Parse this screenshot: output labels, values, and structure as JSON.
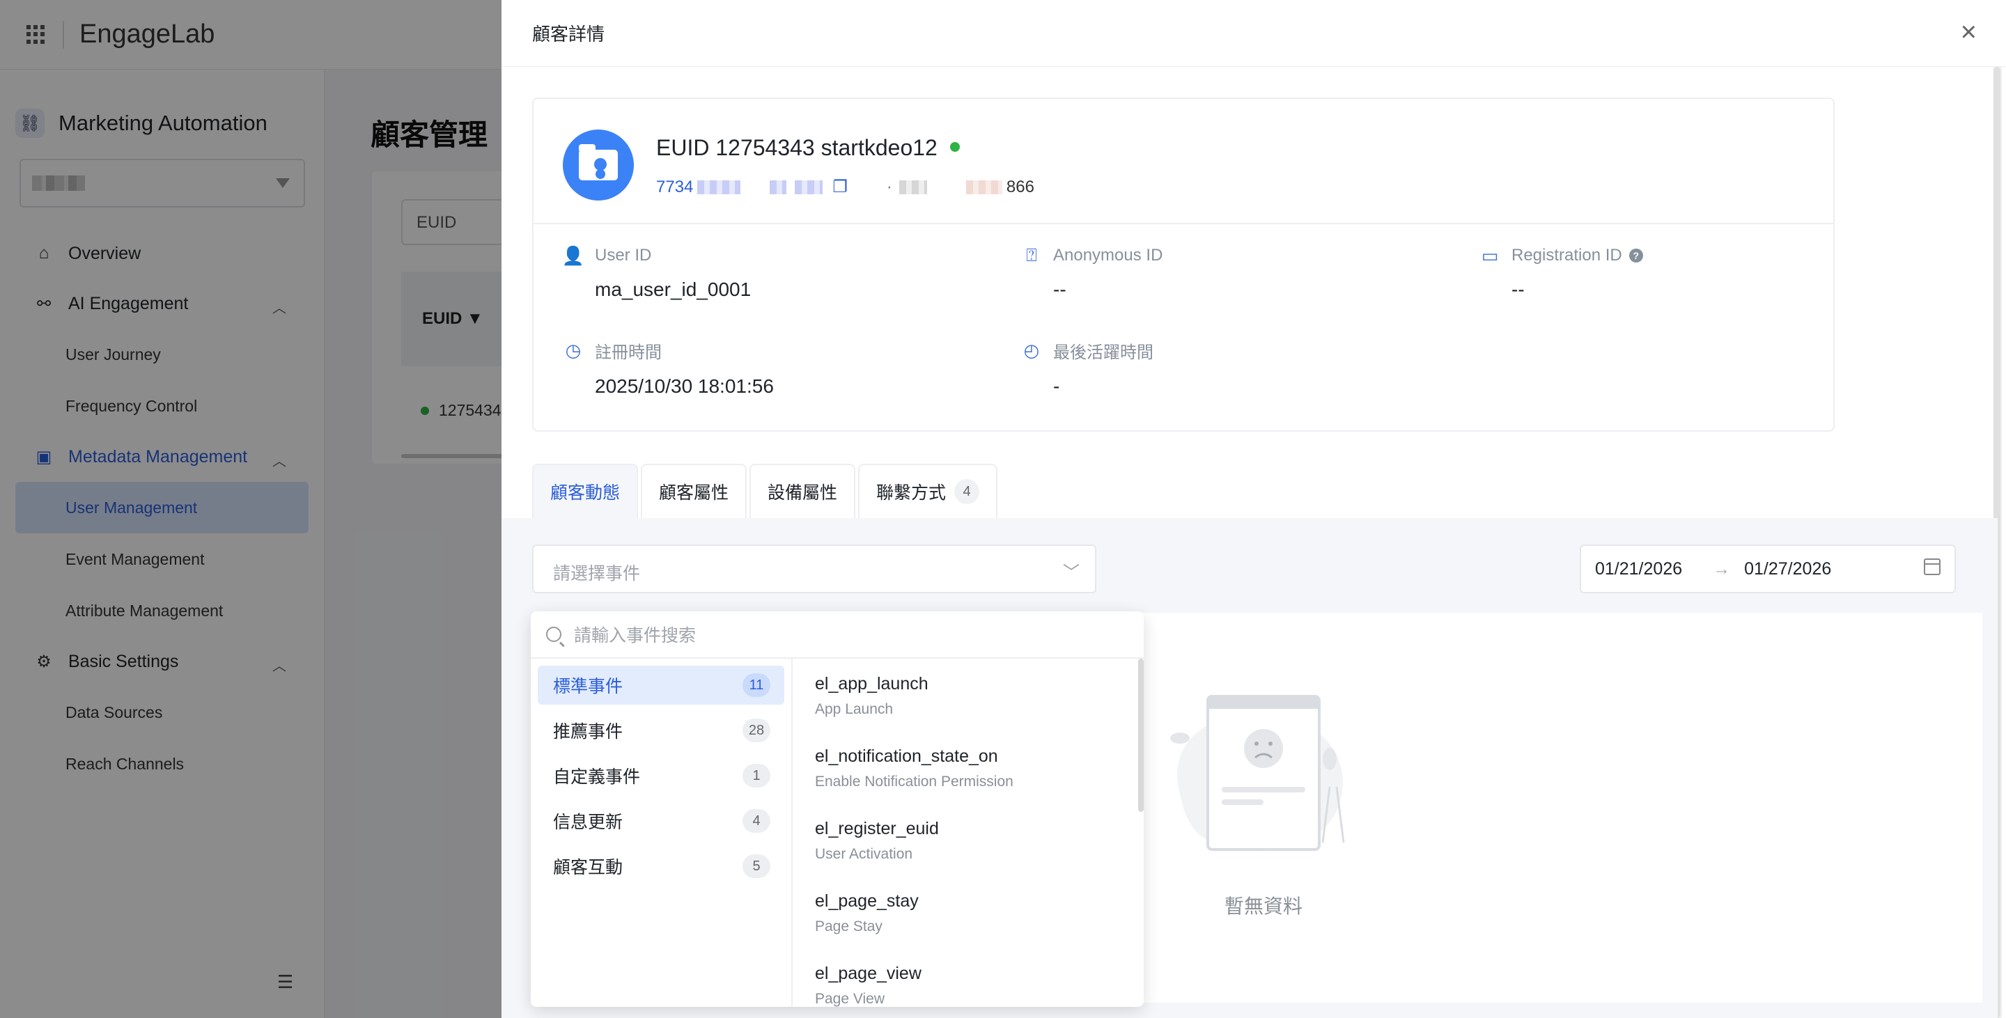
{
  "app": {
    "logo_text": "EngageLab",
    "product": "Marketing Automation",
    "page_title": "顧客管理",
    "nav": {
      "overview": "Overview",
      "ai_engagement": "AI Engagement",
      "user_journey": "User Journey",
      "frequency_control": "Frequency Control",
      "metadata_management": "Metadata Management",
      "user_management": "User Management",
      "event_management": "Event Management",
      "attribute_management": "Attribute Management",
      "basic_settings": "Basic Settings",
      "data_sources": "Data Sources",
      "reach_channels": "Reach Channels"
    },
    "bg_table": {
      "search_placeholder": "EUID",
      "col_euid": "EUID",
      "row_euid": "12754343"
    }
  },
  "drawer": {
    "title": "顧客詳情",
    "profile": {
      "name": "EUID 12754343 startkdeo12",
      "phone_prefix": "7734",
      "tail": "866"
    },
    "attributes": {
      "user_id": {
        "label": "User ID",
        "value": "ma_user_id_0001"
      },
      "anonymous_id": {
        "label": "Anonymous ID",
        "value": "--"
      },
      "registration_id": {
        "label": "Registration ID",
        "value": "--"
      },
      "register_time": {
        "label": "註冊時間",
        "value": "2025/10/30 18:01:56"
      },
      "last_active": {
        "label": "最後活躍時間",
        "value": "-"
      }
    },
    "tabs": [
      {
        "label": "顧客動態"
      },
      {
        "label": "顧客屬性"
      },
      {
        "label": "設備屬性"
      },
      {
        "label": "聯繫方式",
        "count": "4"
      }
    ],
    "event_select_placeholder": "請選擇事件",
    "date_start": "01/21/2026",
    "date_end": "01/27/2026",
    "empty_text": "暫無資料"
  },
  "dropdown": {
    "search_placeholder": "請輸入事件搜索",
    "categories": [
      {
        "label": "標準事件",
        "count": "11"
      },
      {
        "label": "推薦事件",
        "count": "28"
      },
      {
        "label": "自定義事件",
        "count": "1"
      },
      {
        "label": "信息更新",
        "count": "4"
      },
      {
        "label": "顧客互動",
        "count": "5"
      }
    ],
    "events": [
      {
        "code": "el_app_launch",
        "desc": "App Launch"
      },
      {
        "code": "el_notification_state_on",
        "desc": "Enable Notification Permission"
      },
      {
        "code": "el_register_euid",
        "desc": "User Activation"
      },
      {
        "code": "el_page_stay",
        "desc": "Page Stay"
      },
      {
        "code": "el_page_view",
        "desc": "Page View"
      }
    ]
  },
  "colors": {
    "primary": "#2b5ed9",
    "online": "#2fb344",
    "avatar": "#3b82f6"
  }
}
